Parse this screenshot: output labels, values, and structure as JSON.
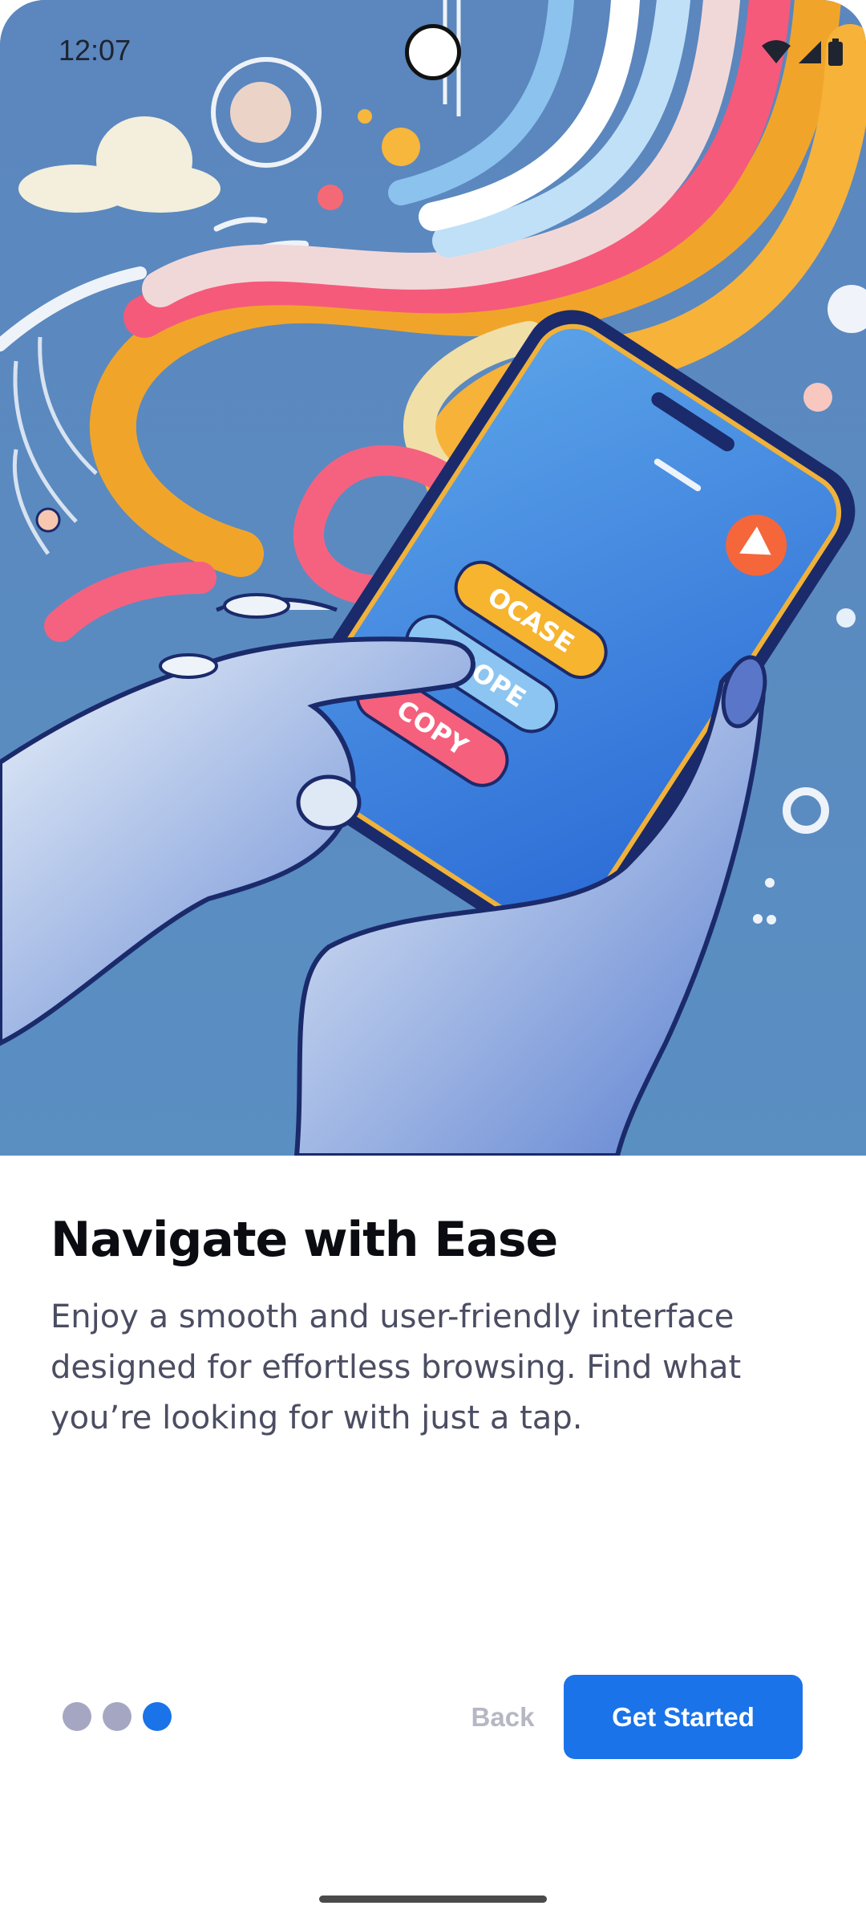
{
  "status_bar": {
    "time": "12:07",
    "icons": [
      "wifi-icon",
      "cell-signal-icon",
      "battery-icon"
    ]
  },
  "hero": {
    "illustration": "hand-holding-phone-illustration",
    "phone_buttons": [
      "OCASE",
      "DBOPE",
      "COPY"
    ]
  },
  "onboarding": {
    "title": "Navigate with Ease",
    "description": "Enjoy a smooth and user-friendly interface designed for effortless browsing. Find what you’re looking for with just a tap.",
    "pager": {
      "total": 3,
      "current": 3
    }
  },
  "actions": {
    "back_label": "Back",
    "primary_label": "Get Started"
  },
  "colors": {
    "accent": "#1a73e8",
    "title": "#0b0b12",
    "body_text": "#4b4d62",
    "inactive_dot": "#a5a7c2",
    "back_text": "#b6b7c3"
  }
}
